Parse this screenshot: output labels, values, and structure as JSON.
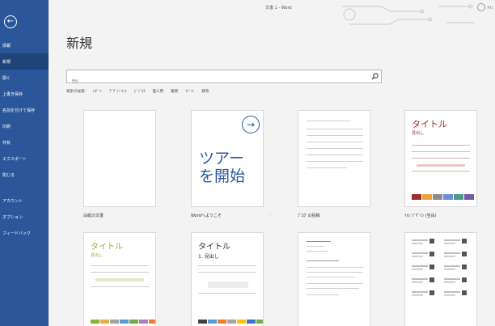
{
  "window": {
    "title": "文書 1 - Word",
    "user": "ｹｲﾝ"
  },
  "sidebar": {
    "back_icon": "arrow-left-icon",
    "items": [
      {
        "label": "情報",
        "active": false
      },
      {
        "label": "新規",
        "active": true
      },
      {
        "label": "開く",
        "active": false
      },
      {
        "label": "上書き保存",
        "active": false
      },
      {
        "label": "名前を付けて保存",
        "active": false
      },
      {
        "label": "印刷",
        "active": false
      },
      {
        "label": "共有",
        "active": false
      },
      {
        "label": "エクスポート",
        "active": false
      },
      {
        "label": "閉じる",
        "active": false
      },
      {
        "label": "アカウント",
        "active": false
      },
      {
        "label": "オプション",
        "active": false
      },
      {
        "label": "フィードバック",
        "active": false
      }
    ]
  },
  "main": {
    "title": "新規",
    "search": {
      "value": "ﾁﾗｼ",
      "placeholder": ""
    },
    "suggested": {
      "label": "検索の候補:",
      "links": [
        "ﾚﾎﾟｰﾄ",
        "ﾃﾞｻﾞｲﾝ ｾｯﾄ",
        "ﾋﾞｼﾞﾈｽ",
        "個人用",
        "業務",
        "ｲﾍﾞﾝﾄ",
        "教育"
      ]
    },
    "templates": [
      {
        "label": "白紙の文書"
      },
      {
        "label": "Wordへようこそ",
        "big_text_1": "ツアー",
        "big_text_2": "を開始"
      },
      {
        "label": "ﾌﾞﾛｸﾞの投稿"
      },
      {
        "label": "ｲｵﾝ ﾃﾞｻﾞｲﾝ (空白)",
        "title": "タイトル",
        "subtitle": "見出し"
      },
      {
        "label": "",
        "title": "タイトル",
        "subtitle": "見出し"
      },
      {
        "label": "",
        "title": "タイトル",
        "subtitle": "1. 見出し"
      },
      {
        "label": ""
      },
      {
        "label": ""
      }
    ]
  },
  "colors": {
    "sidebar": "#2b579a",
    "sidebar_active": "#1e4478",
    "ion_accent": "#a02b32",
    "facet_accent": "#8ab53a",
    "ion_swatches": [
      "#a02b32",
      "#e8a33d",
      "#8c8c8c",
      "#6b8fd1",
      "#4a9a8d",
      "#7a5aa8"
    ],
    "facet_swatches": [
      "#8ab53a",
      "#e2b04a",
      "#a3a3a3",
      "#5b9bd5",
      "#70ad47",
      "#b37bb5",
      "#ed7d31"
    ],
    "t4_swatches": [
      "#404040",
      "#5b9bd5",
      "#ed7d31",
      "#a5a5a5",
      "#ffc000",
      "#4472c4",
      "#70ad47"
    ]
  }
}
